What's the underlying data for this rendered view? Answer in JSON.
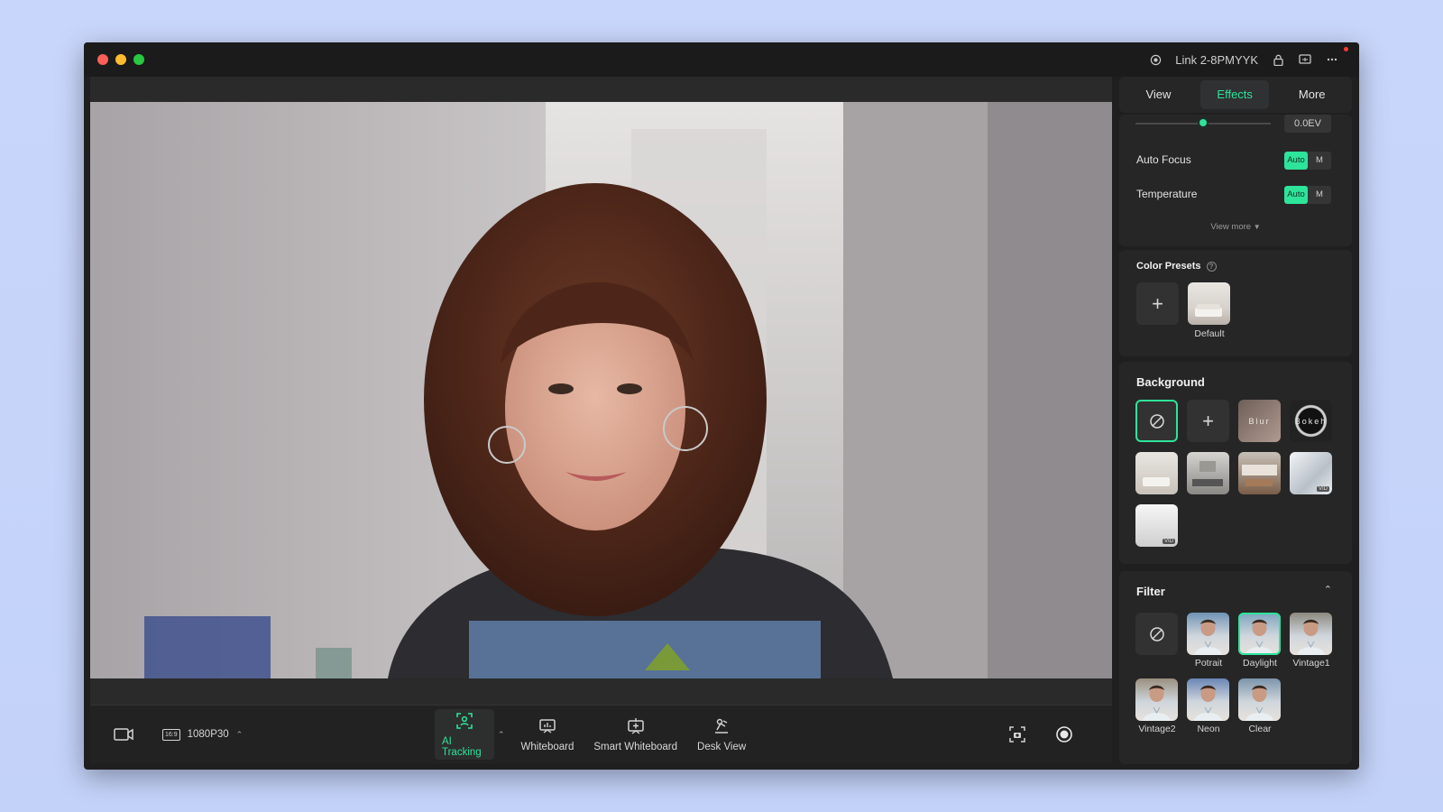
{
  "titlebar": {
    "device": "Link 2-8PMYYK"
  },
  "tabs": [
    {
      "label": "View",
      "active": false
    },
    {
      "label": "Effects",
      "active": true
    },
    {
      "label": "More",
      "active": false
    }
  ],
  "exposure": {
    "value": "0.0EV",
    "level": 0.5
  },
  "settings": [
    {
      "label": "Auto Focus",
      "auto": "Auto",
      "manual": "M"
    },
    {
      "label": "Temperature",
      "auto": "Auto",
      "manual": "M"
    }
  ],
  "view_more": "View more",
  "color_presets": {
    "title": "Color Presets",
    "items": [
      {
        "label": "Default"
      }
    ]
  },
  "background": {
    "title": "Background",
    "blur": "Blur",
    "bokeh": "Bokeh",
    "vid_badge": "VID"
  },
  "filter": {
    "title": "Filter",
    "items": [
      {
        "label": ""
      },
      {
        "label": "Potrait"
      },
      {
        "label": "Daylight"
      },
      {
        "label": "Vintage1"
      },
      {
        "label": "Vintage2"
      },
      {
        "label": "Neon"
      },
      {
        "label": "Clear"
      }
    ]
  },
  "bottombar": {
    "resolution_badge": "16:9",
    "resolution": "1080P30",
    "ai_tracking": "AI Tracking",
    "whiteboard": "Whiteboard",
    "smart_whiteboard": "Smart Whiteboard",
    "desk_view": "Desk View"
  },
  "colors": {
    "accent": "#2ee39a",
    "window": "#1f1f20",
    "panel_card": "#262627"
  },
  "icons": [
    "webcam-icon",
    "lock-icon",
    "cast-icon",
    "more-icon",
    "camera-icon",
    "ai-tracking-icon",
    "whiteboard-icon",
    "smart-whiteboard-icon",
    "desk-view-icon",
    "snapshot-icon",
    "record-icon",
    "plus-icon",
    "none-icon",
    "chevron-up-icon",
    "help-icon"
  ]
}
